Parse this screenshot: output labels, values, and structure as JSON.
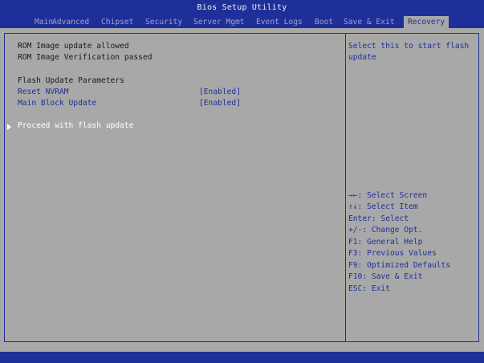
{
  "header": {
    "title": "Bios Setup Utility",
    "tabs": [
      "Main",
      "Advanced",
      "Chipset",
      "Security",
      "Server Mgmt",
      "Event Logs",
      "Boot",
      "Save & Exit",
      "Recovery"
    ],
    "active_tab": "Recovery"
  },
  "main": {
    "status_line_1": "ROM Image update allowed",
    "status_line_2": "ROM Image Verification passed",
    "section_title": "Flash Update Parameters",
    "settings": [
      {
        "label": "Reset NVRAM",
        "value": "[Enabled]"
      },
      {
        "label": "Main Block Update",
        "value": "[Enabled]"
      }
    ],
    "action": "Proceed with flash update"
  },
  "help": {
    "description_line_1": "Select this to start flash",
    "description_line_2": "update",
    "keys": [
      "→←: Select Screen",
      "↑↓: Select Item",
      "Enter: Select",
      "+/-: Change Opt.",
      "F1: General Help",
      "F3: Previous Values",
      "F9: Optimized Defaults",
      "F10: Save & Exit",
      "ESC: Exit"
    ]
  },
  "colors": {
    "background": "#a8a8a8",
    "header": "#1f2f99",
    "text": "#1a1a1a",
    "highlight": "#ffffff"
  }
}
